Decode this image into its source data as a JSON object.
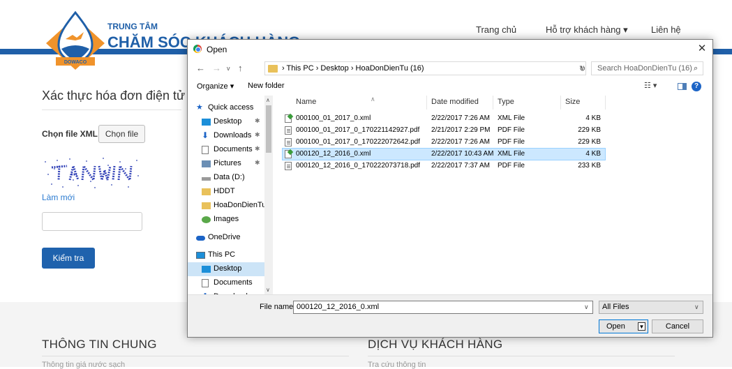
{
  "brand": {
    "logo_text": "DOWACO",
    "small": "TRUNG TÂM",
    "big": "CHĂM SÓC KHÁCH HÀNG",
    "primary_color": "#1f5fa8",
    "accent_color": "#f0932b"
  },
  "nav": {
    "home": "Trang chủ",
    "support": "Hỗ trợ khách hàng ▾",
    "contact": "Liên hệ"
  },
  "page": {
    "title": "Xác thực hóa đơn điện tử",
    "file_label": "Chọn file XML",
    "file_button": "Chọn file",
    "refresh_link": "Làm mới",
    "captcha_value": "",
    "check_button": "Kiểm tra"
  },
  "footer": {
    "col1_title": "THÔNG TIN CHUNG",
    "col1_item": "Thông tin giá nước sạch",
    "col2_title": "DỊCH VỤ KHÁCH HÀNG",
    "col2_item": "Tra cứu thông tin"
  },
  "dialog": {
    "title": "Open",
    "close_glyph": "✕",
    "address": {
      "path": "›  This PC  ›  Desktop  ›  HoaDonDienTu (16)",
      "chevron": "v",
      "refresh": "↻"
    },
    "search_placeholder": "Search HoaDonDienTu (16)",
    "toolbar": {
      "organize": "Organize ▾",
      "new_folder": "New folder",
      "view": "☷ ▾",
      "help": "?"
    },
    "nav_items": [
      {
        "label": "Quick access",
        "icon": "star-icon",
        "pinned": false
      },
      {
        "label": "Desktop",
        "icon": "desktop-folder-icon",
        "pinned": true
      },
      {
        "label": "Downloads",
        "icon": "download-icon",
        "pinned": true
      },
      {
        "label": "Documents",
        "icon": "documents-icon",
        "pinned": true
      },
      {
        "label": "Pictures",
        "icon": "pictures-icon",
        "pinned": true
      },
      {
        "label": "Data (D:)",
        "icon": "drive-icon",
        "pinned": false
      },
      {
        "label": "HDDT",
        "icon": "folder-icon",
        "pinned": false
      },
      {
        "label": "HoaDonDienTu",
        "icon": "folder-icon",
        "pinned": false
      },
      {
        "label": "Images",
        "icon": "images-folder-icon",
        "pinned": false
      },
      {
        "label": "OneDrive",
        "icon": "onedrive-icon",
        "pinned": false
      },
      {
        "label": "This PC",
        "icon": "computer-icon",
        "pinned": false
      },
      {
        "label": "Desktop",
        "icon": "desktop-folder-icon",
        "pinned": false,
        "selected": true
      },
      {
        "label": "Documents",
        "icon": "documents-icon",
        "pinned": false
      },
      {
        "label": "Downloads",
        "icon": "download-icon",
        "pinned": false
      }
    ],
    "pin_glyph": "✱",
    "columns": {
      "name": "Name",
      "date": "Date modified",
      "type": "Type",
      "size": "Size"
    },
    "files": [
      {
        "name": "000100_01_2017_0.xml",
        "date": "2/22/2017 7:26 AM",
        "type": "XML File",
        "size": "4 KB",
        "kind": "xml"
      },
      {
        "name": "000100_01_2017_0_170221142927.pdf",
        "date": "2/21/2017 2:29 PM",
        "type": "PDF File",
        "size": "229 KB",
        "kind": "pdf"
      },
      {
        "name": "000100_01_2017_0_170222072642.pdf",
        "date": "2/22/2017 7:26 AM",
        "type": "PDF File",
        "size": "229 KB",
        "kind": "pdf"
      },
      {
        "name": "000120_12_2016_0.xml",
        "date": "2/22/2017 10:43 AM",
        "type": "XML File",
        "size": "4 KB",
        "kind": "xml",
        "selected": true
      },
      {
        "name": "000120_12_2016_0_170222073718.pdf",
        "date": "2/22/2017 7:37 AM",
        "type": "PDF File",
        "size": "233 KB",
        "kind": "pdf"
      }
    ],
    "file_name_label": "File name:",
    "file_name_value": "000120_12_2016_0.xml",
    "file_type_value": "All Files",
    "open_button": "Open",
    "cancel_button": "Cancel"
  }
}
